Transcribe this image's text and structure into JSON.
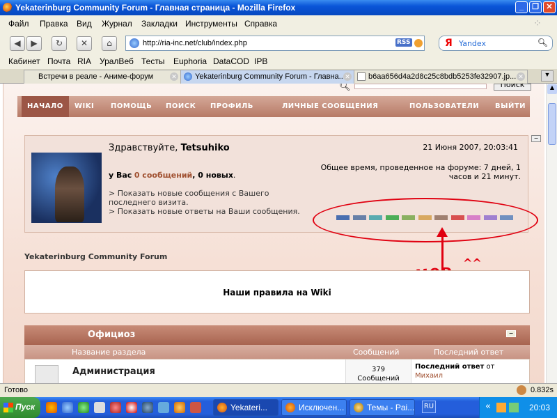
{
  "window": {
    "title": "Yekaterinburg Community Forum - Главная страница - Mozilla Firefox"
  },
  "menu": [
    "Файл",
    "Правка",
    "Вид",
    "Журнал",
    "Закладки",
    "Инструменты",
    "Справка"
  ],
  "nav": {
    "url": "http://ria-inc.net/club/index.php",
    "rss": "RSS",
    "search_placeholder": "Yandex"
  },
  "bookmarks": [
    "Кабинет",
    "Почта",
    "RIA",
    "УралВеб",
    "Тесты",
    "Euphoria",
    "DataCOD",
    "IPB"
  ],
  "tabs": [
    {
      "label": "Встречи в реале - Аниме-форум"
    },
    {
      "label": "Yekaterinburg Community Forum - Главна..."
    },
    {
      "label": "b6aa656d4a2d8c25c8bdb5253fe32907.jp..."
    }
  ],
  "forum": {
    "search_button": "Поиск",
    "nav": [
      "НАЧАЛО",
      "WIKI",
      "ПОМОЩЬ",
      "ПОИСК",
      "ПРОФИЛЬ",
      "ЛИЧНЫЕ СООБЩЕНИЯ",
      "ПОЛЬЗОВАТЕЛИ",
      "ВЫЙТИ"
    ],
    "greeting": "Здравствуйте,",
    "username": "Tetsuhiko",
    "datetime": "21 Июня 2007, 20:03:41",
    "messages_prefix": "у Вас",
    "messages_link": "0 сообщений",
    "messages_suffix": ", 0 новых",
    "time_online": "Общее время, проведенное на форуме: 7 дней, 1 часов и 21 минут.",
    "link1": "> Показать новые сообщения с Вашего последнего визита.",
    "link2": "> Показать новые ответы на Ваши сообщения.",
    "swatch_colors": [
      "#4a6fb0",
      "#6880a8",
      "#5aabb0",
      "#4cae58",
      "#8ab060",
      "#d8a860",
      "#a08070",
      "#d85050",
      "#d880c8",
      "#a080d0",
      "#7090c0"
    ],
    "annotation_text": "MOD",
    "annotation_smile": "^^",
    "forum_title": "Yekaterinburg Community Forum",
    "rules_text": "Наши правила на Wiki",
    "category": "Официоз",
    "columns": [
      "Название раздела",
      "Сообщений",
      "Последний ответ"
    ],
    "row": {
      "name": "Администрация",
      "count": "379",
      "count_label": "Сообщений",
      "last_label": "Последний ответ",
      "last_from": "от",
      "last_author": "Михаил"
    }
  },
  "status": {
    "text": "Готово",
    "time": "0.832s"
  },
  "taskbar": {
    "start": "Пуск",
    "tasks": [
      "Yekateri...",
      "Исключен...",
      "Темы - Pai..."
    ],
    "lang": "RU",
    "clock": "20:03"
  }
}
